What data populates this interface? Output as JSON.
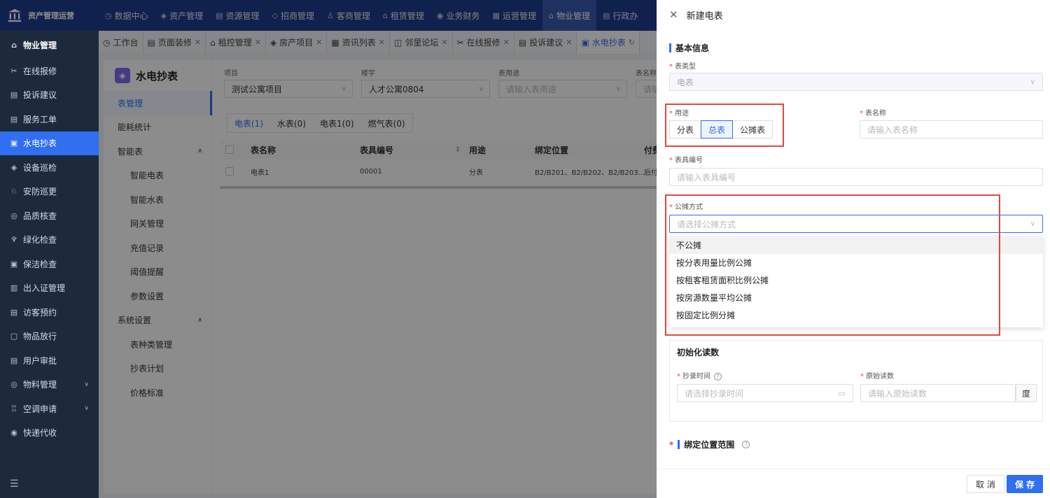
{
  "app": {
    "title": "资产管理运营"
  },
  "topmenu": [
    {
      "icon": "◷",
      "label": "数据中心"
    },
    {
      "icon": "◈",
      "label": "资产管理"
    },
    {
      "icon": "▤",
      "label": "资源管理"
    },
    {
      "icon": "◇",
      "label": "招商管理"
    },
    {
      "icon": "♙",
      "label": "客商管理"
    },
    {
      "icon": "⌂",
      "label": "租赁管理"
    },
    {
      "icon": "◉",
      "label": "业务财务"
    },
    {
      "icon": "▦",
      "label": "运营管理"
    },
    {
      "icon": "⌂",
      "label": "物业管理"
    },
    {
      "icon": "▤",
      "label": "行政办"
    }
  ],
  "sidebar": {
    "header": "物业管理",
    "items": [
      {
        "icon": "✂",
        "label": "在线报修"
      },
      {
        "icon": "▤",
        "label": "投诉建议"
      },
      {
        "icon": "▤",
        "label": "服务工单"
      },
      {
        "icon": "▣",
        "label": "水电抄表"
      },
      {
        "icon": "◈",
        "label": "设备巡检"
      },
      {
        "icon": "♘",
        "label": "安防巡更"
      },
      {
        "icon": "◎",
        "label": "品质核查"
      },
      {
        "icon": "♆",
        "label": "绿化检查"
      },
      {
        "icon": "▣",
        "label": "保洁检查"
      },
      {
        "icon": "▥",
        "label": "出入证管理"
      },
      {
        "icon": "▤",
        "label": "访客预约"
      },
      {
        "icon": "▢",
        "label": "物品放行"
      },
      {
        "icon": "▤",
        "label": "用户审批"
      },
      {
        "icon": "◎",
        "label": "物料管理"
      },
      {
        "icon": "♖",
        "label": "空调申请"
      },
      {
        "icon": "◉",
        "label": "快递代收"
      }
    ]
  },
  "tabs": [
    {
      "icon": "◷",
      "label": "工作台"
    },
    {
      "icon": "▤",
      "label": "页面装修"
    },
    {
      "icon": "⌂",
      "label": "租控管理"
    },
    {
      "icon": "◈",
      "label": "房产项目"
    },
    {
      "icon": "▦",
      "label": "资讯列表"
    },
    {
      "icon": "◫",
      "label": "邻里论坛"
    },
    {
      "icon": "✂",
      "label": "在线报修"
    },
    {
      "icon": "▤",
      "label": "投诉建议"
    },
    {
      "icon": "▣",
      "label": "水电抄表"
    }
  ],
  "subnav": {
    "title": "水电抄表",
    "items": [
      {
        "label": "表管理"
      },
      {
        "label": "能耗统计"
      },
      {
        "label": "智能表"
      },
      {
        "label": "智能电表"
      },
      {
        "label": "智能水表"
      },
      {
        "label": "网关管理"
      },
      {
        "label": "充值记录"
      },
      {
        "label": "阈值提醒"
      },
      {
        "label": "参数设置"
      },
      {
        "label": "系统设置"
      },
      {
        "label": "表种类管理"
      },
      {
        "label": "抄表计划"
      },
      {
        "label": "价格标准"
      }
    ]
  },
  "filters": {
    "project_label": "项目",
    "project_value": "测试公寓项目",
    "building_label": "楼宇",
    "building_value": "人才公寓0804",
    "usage_label": "表用途",
    "usage_placeholder": "请输入表用途",
    "name_label": "表名称",
    "name_placeholder": "请输"
  },
  "type_tabs": [
    "电表(1)",
    "水表(0)",
    "电表1(0)",
    "燃气表(0)"
  ],
  "table": {
    "headers": [
      "表名称",
      "表具编号",
      "用途",
      "绑定位置",
      "付费"
    ],
    "rows": [
      {
        "name": "电表1",
        "code": "00001",
        "usage": "分表",
        "location": "B2/B201、B2/B202、B2/B203...",
        "pay": "后付"
      }
    ]
  },
  "drawer": {
    "title": "新建电表",
    "section_basic": "基本信息",
    "meter_type_label": "表类型",
    "meter_type_value": "电表",
    "usage_label": "用途",
    "usage_options": [
      "分表",
      "总表",
      "公摊表"
    ],
    "meter_name_label": "表名称",
    "meter_name_placeholder": "请输入表名称",
    "meter_code_label": "表具编号",
    "meter_code_placeholder": "请输入表具编号",
    "share_label": "公摊方式",
    "share_placeholder": "请选择公摊方式",
    "share_options": [
      "不公摊",
      "按分表用量比例公摊",
      "按租客租赁面积比例公摊",
      "按房源数量平均公摊",
      "按固定比例分摊"
    ],
    "init_title": "初始化读数",
    "read_time_label": "抄录时间",
    "read_time_placeholder": "请选择抄录时间",
    "orig_reading_label": "原始读数",
    "orig_reading_placeholder": "请输入原始读数",
    "unit": "度",
    "bind_title": "绑定位置范围",
    "cancel": "取 消",
    "save": "保 存"
  }
}
